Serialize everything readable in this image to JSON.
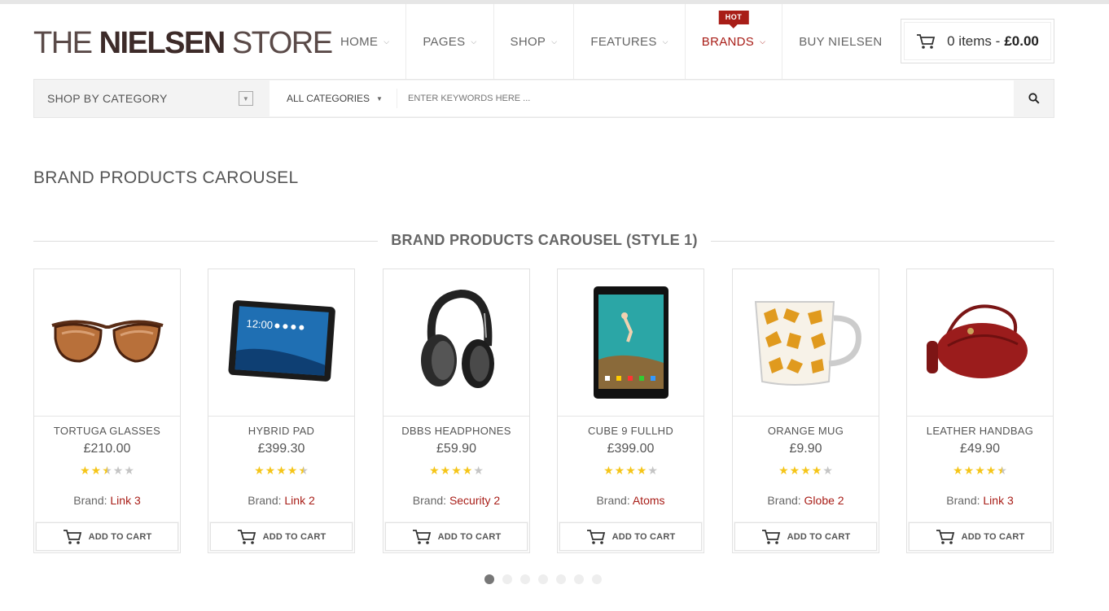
{
  "logo": {
    "part1": "THE ",
    "part2": "NIELSEN",
    "part3": " STORE"
  },
  "nav": {
    "items": [
      {
        "label": "HOME",
        "has_dropdown": true
      },
      {
        "label": "PAGES",
        "has_dropdown": true
      },
      {
        "label": "SHOP",
        "has_dropdown": true
      },
      {
        "label": "FEATURES",
        "has_dropdown": true
      },
      {
        "label": "BRANDS",
        "has_dropdown": true,
        "badge": "HOT"
      },
      {
        "label": "BUY NIELSEN",
        "has_dropdown": false
      }
    ]
  },
  "cart": {
    "items_text": "0 items -",
    "total": "£0.00",
    "icon": "cart-icon"
  },
  "search": {
    "category_toggle_label": "SHOP BY CATEGORY",
    "category_select_value": "ALL CATEGORIES",
    "placeholder": "ENTER KEYWORDS HERE ...",
    "icon": "search-icon"
  },
  "page_heading": "BRAND PRODUCTS CAROUSEL",
  "section_title": "BRAND PRODUCTS CAROUSEL (STYLE 1)",
  "products": [
    {
      "name": "TORTUGA GLASSES",
      "price": "£210.00",
      "rating": 2.5,
      "brand_label": "Brand:",
      "brand": "Link 3",
      "button": "ADD TO CART",
      "image": "sunglasses"
    },
    {
      "name": "HYBRID PAD",
      "price": "£399.30",
      "rating": 4.5,
      "brand_label": "Brand:",
      "brand": "Link 2",
      "button": "ADD TO CART",
      "image": "tablet"
    },
    {
      "name": "DBBS HEADPHONES",
      "price": "£59.90",
      "rating": 4,
      "brand_label": "Brand:",
      "brand": "Security 2",
      "button": "ADD TO CART",
      "image": "headphones"
    },
    {
      "name": "CUBE 9 FULLHD",
      "price": "£399.00",
      "rating": 4,
      "brand_label": "Brand:",
      "brand": "Atoms",
      "button": "ADD TO CART",
      "image": "tablet-portrait"
    },
    {
      "name": "ORANGE MUG",
      "price": "£9.90",
      "rating": 4,
      "brand_label": "Brand:",
      "brand": "Globe 2",
      "button": "ADD TO CART",
      "image": "mug"
    },
    {
      "name": "LEATHER HANDBAG",
      "price": "£49.90",
      "rating": 4.5,
      "brand_label": "Brand:",
      "brand": "Link 3",
      "button": "ADD TO CART",
      "image": "handbag"
    }
  ],
  "carousel": {
    "page_count": 7,
    "active_page": 1
  },
  "colors": {
    "accent": "#a81d17",
    "star": "#f5c518",
    "star_off": "#c4c4c4"
  }
}
